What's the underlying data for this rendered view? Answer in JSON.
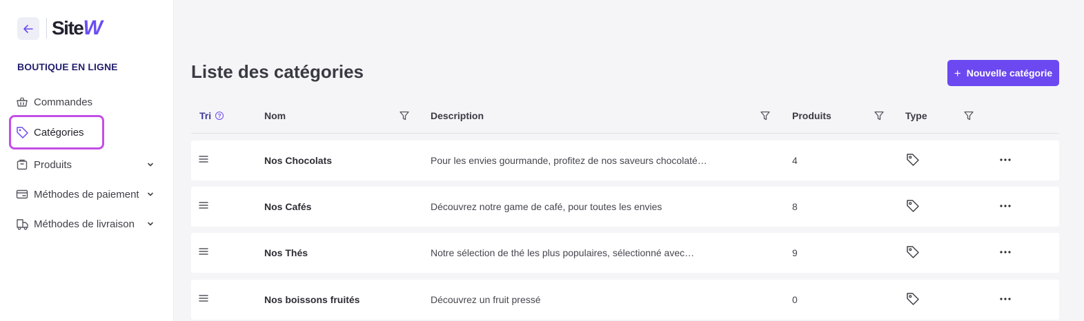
{
  "sidebar": {
    "brand": {
      "prefix": "Site",
      "suffix": "W"
    },
    "section_title": "BOUTIQUE EN LIGNE",
    "items": [
      {
        "label": "Commandes",
        "icon": "basket-icon"
      },
      {
        "label": "Catégories",
        "icon": "tag-icon",
        "active": true
      },
      {
        "label": "Produits",
        "icon": "package-icon",
        "expandable": true
      },
      {
        "label": "Méthodes de paiement",
        "icon": "credit-card-icon",
        "expandable": true
      },
      {
        "label": "Méthodes de livraison",
        "icon": "delivery-truck-icon",
        "expandable": true
      }
    ]
  },
  "main": {
    "title": "Liste des catégories",
    "new_button_label": "Nouvelle catégorie",
    "columns": {
      "sort": "Tri",
      "name": "Nom",
      "description": "Description",
      "products": "Produits",
      "type": "Type"
    },
    "rows": [
      {
        "name": "Nos Chocolats",
        "description": "Pour les envies gourmande, profitez de nos saveurs chocolaté…",
        "products": "4"
      },
      {
        "name": "Nos Cafés",
        "description": "Découvrez notre game de café, pour toutes les envies",
        "products": "8"
      },
      {
        "name": "Nos Thés",
        "description": "Notre sélection de thé les plus populaires, sélectionné avec…",
        "products": "9"
      },
      {
        "name": "Nos boissons fruités",
        "description": "Découvrez un fruit pressé",
        "products": "0"
      }
    ]
  },
  "colors": {
    "accent": "#6b48f0",
    "active_outline": "#c24ee6",
    "section_title": "#231f6e"
  }
}
